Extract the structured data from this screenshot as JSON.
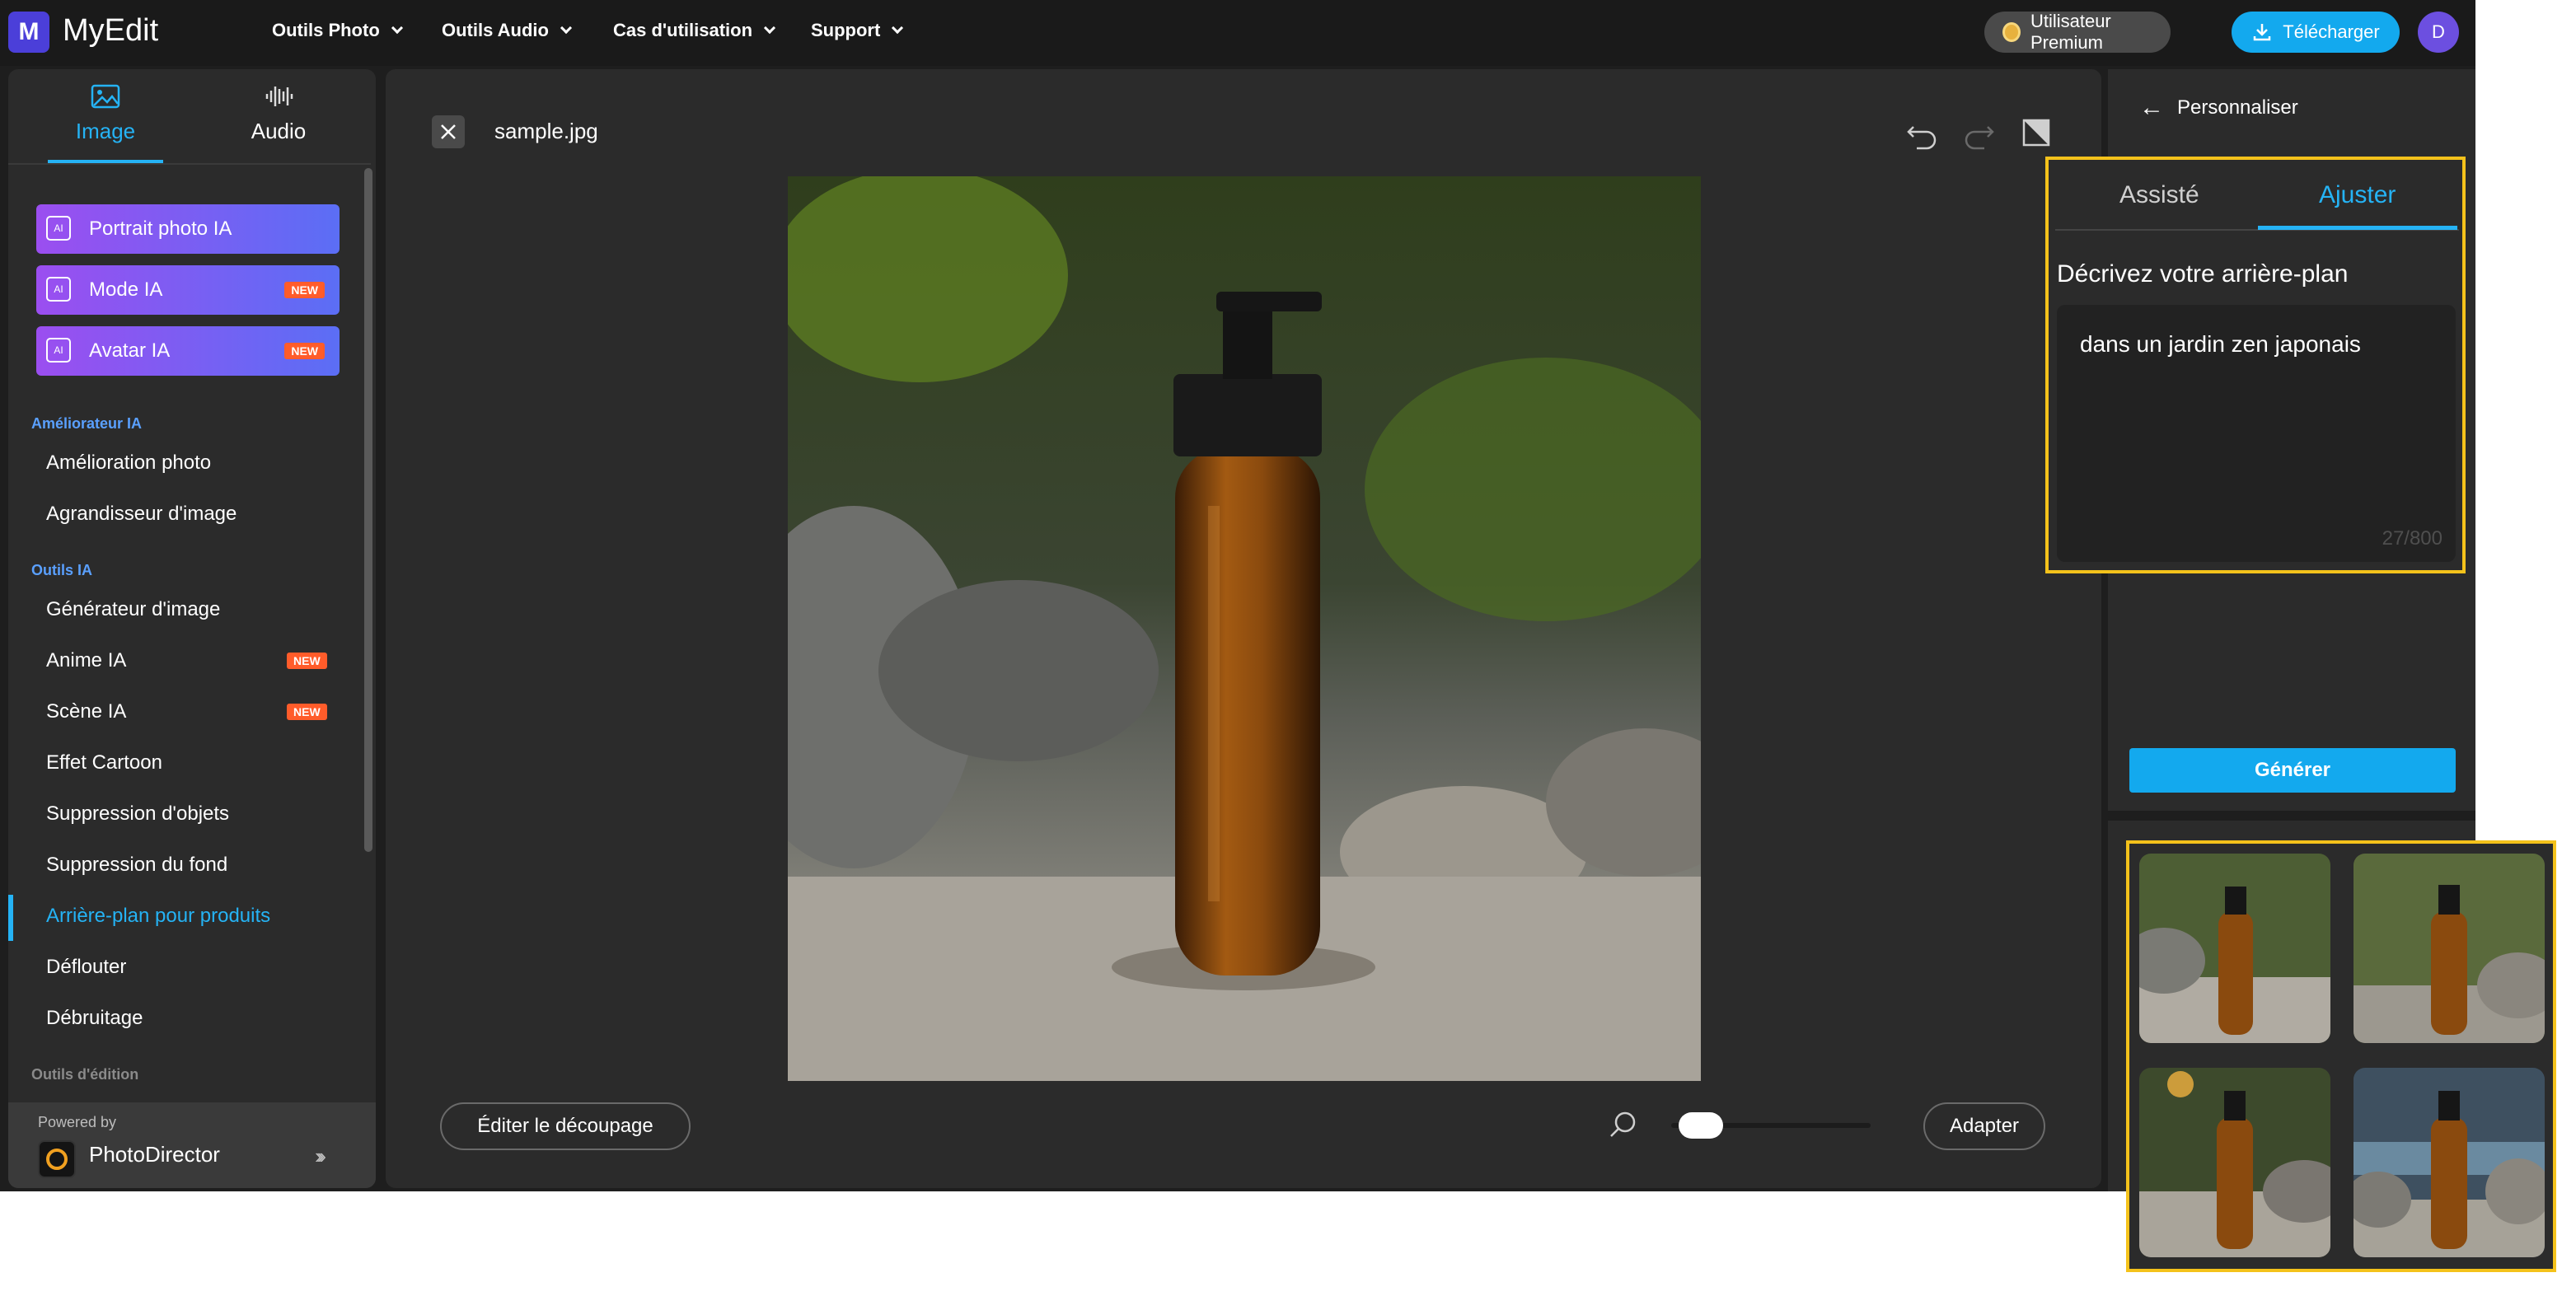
{
  "header": {
    "brand": "MyEdit",
    "logo_letter": "M",
    "nav": [
      "Outils Photo",
      "Outils Audio",
      "Cas d'utilisation",
      "Support"
    ],
    "premium_label": "Utilisateur Premium",
    "download_label": "Télécharger",
    "avatar_letter": "D"
  },
  "sidebar": {
    "tabs": [
      "Image",
      "Audio"
    ],
    "ai_buttons": [
      {
        "label": "Portrait photo IA",
        "badge": ""
      },
      {
        "label": "Mode IA",
        "badge": "NEW"
      },
      {
        "label": "Avatar IA",
        "badge": "NEW"
      }
    ],
    "sections": {
      "enhancer": "Améliorateur IA",
      "tools": "Outils IA",
      "editing": "Outils d'édition"
    },
    "enhancer_items": [
      "Amélioration photo",
      "Agrandisseur d'image"
    ],
    "tool_items": [
      {
        "label": "Générateur d'image",
        "badge": ""
      },
      {
        "label": "Anime IA",
        "badge": "NEW"
      },
      {
        "label": "Scène IA",
        "badge": "NEW"
      },
      {
        "label": "Effet Cartoon",
        "badge": ""
      },
      {
        "label": "Suppression d'objets",
        "badge": ""
      },
      {
        "label": "Suppression du fond",
        "badge": ""
      },
      {
        "label": "Arrière-plan pour produits",
        "badge": ""
      },
      {
        "label": "Déflouter",
        "badge": ""
      },
      {
        "label": "Débruitage",
        "badge": ""
      }
    ],
    "active_item": "Arrière-plan pour produits",
    "powered_by": "Powered by",
    "powered_name": "PhotoDirector"
  },
  "canvas": {
    "filename": "sample.jpg",
    "edit_crop_label": "Éditer le découpage",
    "fit_label": "Adapter",
    "zoom_level": 0.05
  },
  "panel": {
    "back_label": "Personnaliser",
    "tabs": [
      "Assisté",
      "Ajuster"
    ],
    "active_tab": "Ajuster",
    "describe_label": "Décrivez votre arrière-plan",
    "prompt_value": "dans un jardin zen japonais",
    "char_count": "27/800",
    "generate_label": "Générer"
  },
  "colors": {
    "accent": "#25b3f5",
    "highlight": "#f4c21b",
    "new_badge": "#ff5c2a",
    "ai_gradient_start": "#9b4ef0",
    "ai_gradient_end": "#5b6ef5"
  }
}
